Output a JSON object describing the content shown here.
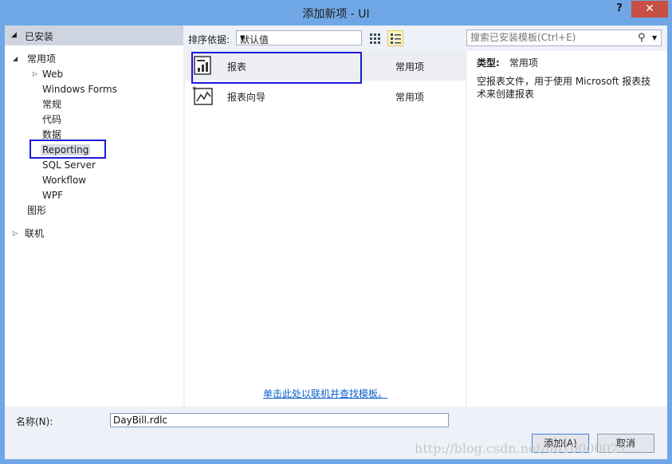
{
  "window": {
    "title": "添加新项 - UI",
    "help_label": "?",
    "close_label": "✕"
  },
  "left_pane": {
    "installed_label": "已安装",
    "tree": [
      {
        "label": "常用项",
        "expanded": true
      },
      {
        "label": "Web"
      },
      {
        "label": "Windows Forms"
      },
      {
        "label": "常规"
      },
      {
        "label": "代码"
      },
      {
        "label": "数据"
      },
      {
        "label": "Reporting",
        "selected": true
      },
      {
        "label": "SQL Server"
      },
      {
        "label": "Workflow"
      },
      {
        "label": "WPF"
      },
      {
        "label": "图形"
      },
      {
        "label": "联机"
      }
    ]
  },
  "toolbar": {
    "sort_label": "排序依据:",
    "sort_value": "默认值",
    "search_placeholder": "搜索已安装模板(Ctrl+E)"
  },
  "templates": [
    {
      "name": "报表",
      "category": "常用项",
      "icon": "report-icon",
      "selected": true
    },
    {
      "name": "报表向导",
      "category": "常用项",
      "icon": "report-wizard-icon"
    }
  ],
  "online_link": "单击此处以联机并查找模板。",
  "details": {
    "type_label": "类型:",
    "type_value": "常用项",
    "description": "空报表文件，用于使用 Microsoft 报表技术来创建报表"
  },
  "bottom": {
    "name_label": "名称(N):",
    "name_value": "DayBill.rdlc",
    "add_label": "添加(A)",
    "cancel_label": "取消"
  },
  "watermark": "http://blog.csdn.net/u010000027",
  "colors": {
    "title_bar": "#6fa7e6",
    "close_button": "#c74f44",
    "highlight_box": "#1a1ad8",
    "link": "#0b5fd1"
  }
}
